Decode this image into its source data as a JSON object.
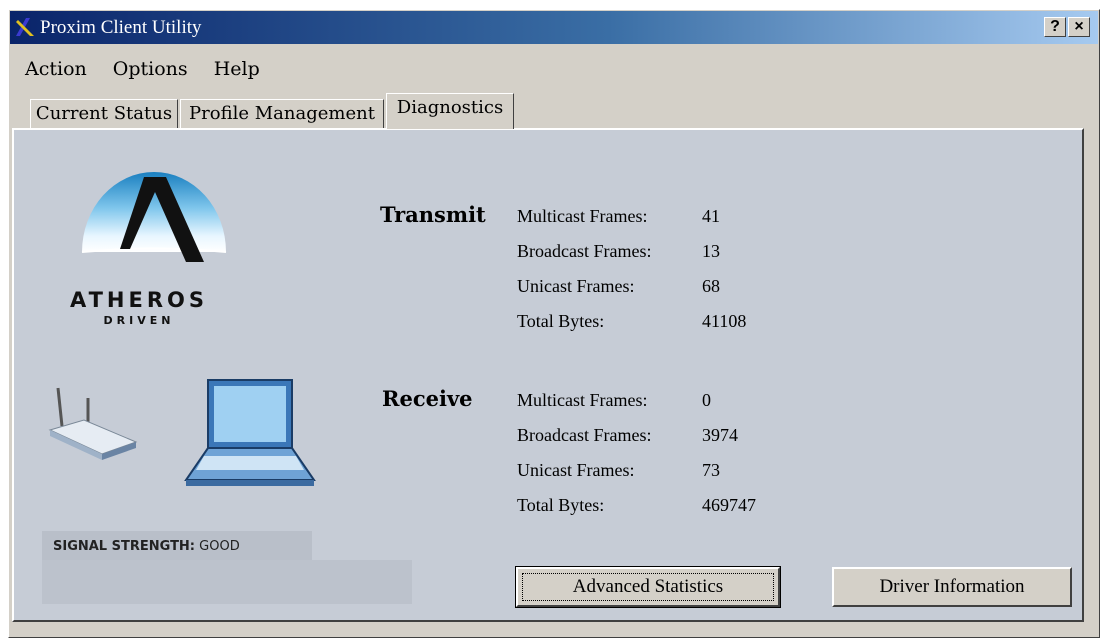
{
  "window": {
    "title": "Proxim Client Utility"
  },
  "title_buttons": {
    "help": "?",
    "close": "×"
  },
  "menu": [
    {
      "label": "Action"
    },
    {
      "label": "Options"
    },
    {
      "label": "Help"
    }
  ],
  "tabs": [
    {
      "label": "Current Status"
    },
    {
      "label": "Profile Management"
    },
    {
      "label": "Diagnostics",
      "active": true
    }
  ],
  "logo": {
    "brand": "ATHEROS",
    "tagline": "DRIVEN"
  },
  "signal": {
    "label": "SIGNAL STRENGTH:",
    "value": "GOOD"
  },
  "transmit": {
    "heading": "Transmit",
    "rows": [
      {
        "label": "Multicast Frames:",
        "value": "41"
      },
      {
        "label": "Broadcast Frames:",
        "value": "13"
      },
      {
        "label": "Unicast Frames:",
        "value": "68"
      },
      {
        "label": "Total Bytes:",
        "value": "41108"
      }
    ]
  },
  "receive": {
    "heading": "Receive",
    "rows": [
      {
        "label": "Multicast Frames:",
        "value": "0"
      },
      {
        "label": "Broadcast Frames:",
        "value": "3974"
      },
      {
        "label": "Unicast Frames:",
        "value": "73"
      },
      {
        "label": "Total Bytes:",
        "value": "469747"
      }
    ]
  },
  "buttons": {
    "advanced": "Advanced Statistics",
    "driver": "Driver Information"
  },
  "colors": {
    "title_start": "#0a246a",
    "title_end": "#a6caf0",
    "panel": "#c6ccd6",
    "face": "#d4d0c8"
  }
}
